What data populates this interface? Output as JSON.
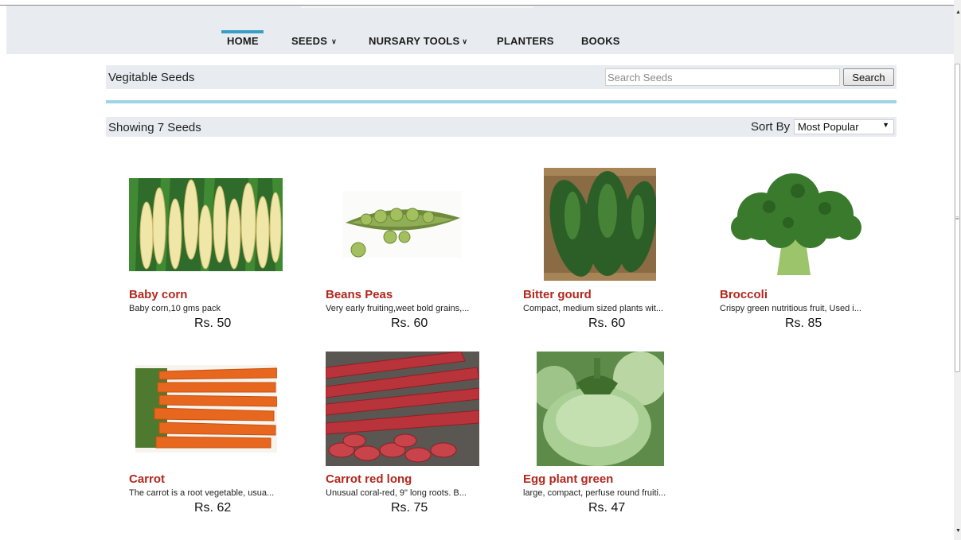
{
  "nav": {
    "items": [
      {
        "label": "HOME"
      },
      {
        "label": "SEEDS"
      },
      {
        "label": "NURSARY TOOLS"
      },
      {
        "label": "PLANTERS"
      },
      {
        "label": "BOOKS"
      }
    ],
    "active": "HOME"
  },
  "category": {
    "title": "Vegitable Seeds",
    "search_placeholder": "Search Seeds",
    "search_value": "",
    "search_button": "Search"
  },
  "listing": {
    "showing_text": "Showing 7 Seeds",
    "sort_label": "Sort By",
    "sort_selected": "Most Popular"
  },
  "products": [
    {
      "name": "Baby corn",
      "desc": "Baby corn,10 gms pack",
      "price": "Rs. 50",
      "image": "baby-corn-image"
    },
    {
      "name": "Beans Peas",
      "desc": "Very early fruiting,weet bold grains,...",
      "price": "Rs. 60",
      "image": "pea-pod-image"
    },
    {
      "name": "Bitter gourd",
      "desc": "Compact, medium sized plants wit...",
      "price": "Rs. 60",
      "image": "bitter-gourd-image"
    },
    {
      "name": "Broccoli",
      "desc": "Crispy green nutritious fruit, Used i...",
      "price": "Rs. 85",
      "image": "broccoli-image"
    },
    {
      "name": "Carrot",
      "desc": "The carrot is a root vegetable, usua...",
      "price": "Rs. 62",
      "image": "carrot-image"
    },
    {
      "name": "Carrot red long",
      "desc": "Unusual coral-red, 9\" long roots. B...",
      "price": "Rs. 75",
      "image": "red-carrot-image"
    },
    {
      "name": "Egg plant green",
      "desc": "large, compact, perfuse round fruiti...",
      "price": "Rs. 47",
      "image": "green-eggplant-image"
    }
  ],
  "colors": {
    "accent": "#35a0c4",
    "divider": "#9fd3e6",
    "product_title": "#b2281e",
    "bar_bg": "#e8ecf1"
  }
}
